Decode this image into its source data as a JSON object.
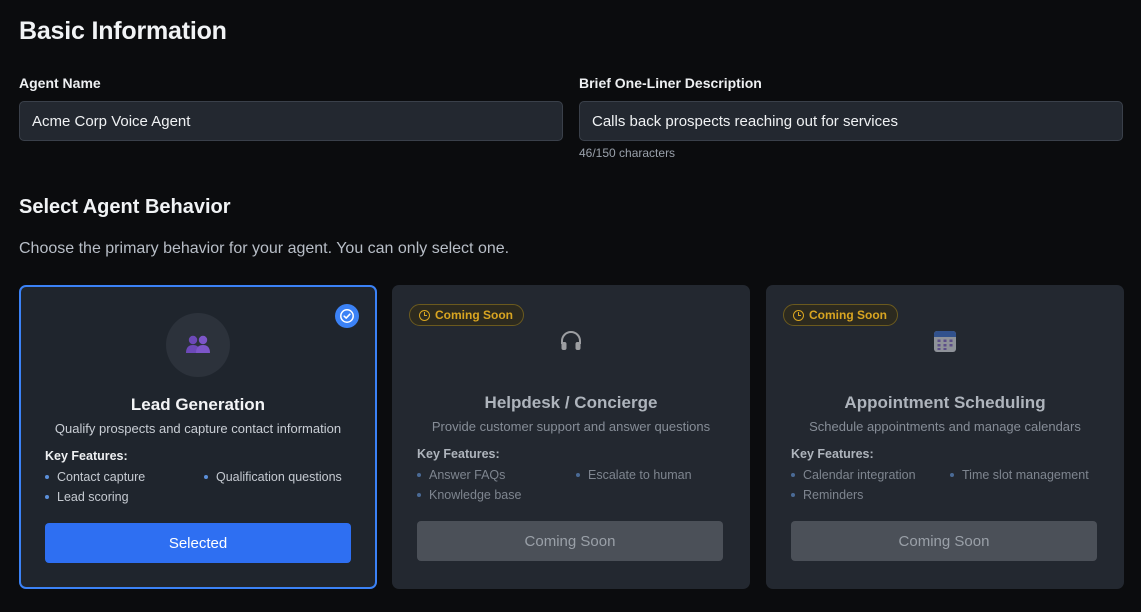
{
  "basic_info": {
    "heading": "Basic Information",
    "agent_name_label": "Agent Name",
    "agent_name_value": "Acme Corp Voice Agent",
    "description_label": "Brief One-Liner Description",
    "description_value": "Calls back prospects reaching out for services",
    "character_count": "46/150 characters"
  },
  "behavior": {
    "heading": "Select Agent Behavior",
    "subtitle": "Choose the primary behavior for your agent. You can only select one.",
    "key_features_label": "Key Features:",
    "cards": [
      {
        "title": "Lead Generation",
        "description": "Qualify prospects and capture contact information",
        "icon": "users-icon",
        "features": [
          "Contact capture",
          "Qualification questions",
          "Lead scoring"
        ],
        "button_label": "Selected",
        "selected": true
      },
      {
        "title": "Helpdesk / Concierge",
        "description": "Provide customer support and answer questions",
        "icon": "headphones-icon",
        "badge": "Coming Soon",
        "features": [
          "Answer FAQs",
          "Escalate to human",
          "Knowledge base"
        ],
        "button_label": "Coming Soon",
        "selected": false
      },
      {
        "title": "Appointment Scheduling",
        "description": "Schedule appointments and manage calendars",
        "icon": "calendar-icon",
        "badge": "Coming Soon",
        "features": [
          "Calendar integration",
          "Time slot management",
          "Reminders"
        ],
        "button_label": "Coming Soon",
        "selected": false
      }
    ]
  },
  "colors": {
    "accent": "#3b82f6",
    "primary_button": "#2e6ff2",
    "badge_text": "#d9a521",
    "background": "#0b0c0e",
    "card": "#232830"
  }
}
